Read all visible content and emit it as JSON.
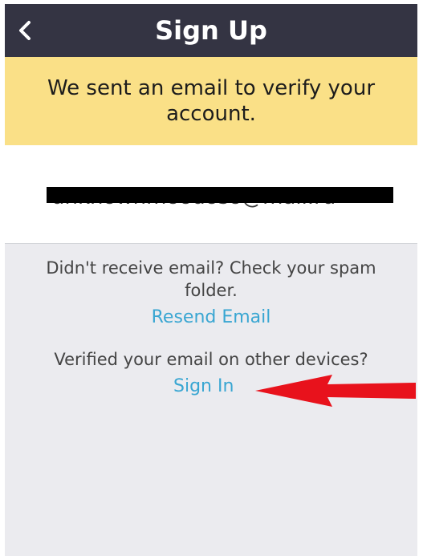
{
  "header": {
    "title": "Sign Up",
    "back_icon": "chevron-left-icon"
  },
  "notice": {
    "text": "We sent an email to verify your account."
  },
  "email": {
    "value": "unknownmoodoso@mail.ru",
    "redacted": true
  },
  "help": {
    "no_email_text": "Didn't receive email? Check your spam folder.",
    "resend_label": "Resend Email",
    "verified_text": "Verified your email on other devices?",
    "signin_label": "Sign In"
  },
  "annotation": {
    "arrow_icon": "red-arrow-left-icon",
    "arrow_color": "#e8121c"
  },
  "colors": {
    "header_bg": "#343443",
    "notice_bg": "#fae087",
    "lower_bg": "#ebebef",
    "link": "#39a6d2"
  }
}
